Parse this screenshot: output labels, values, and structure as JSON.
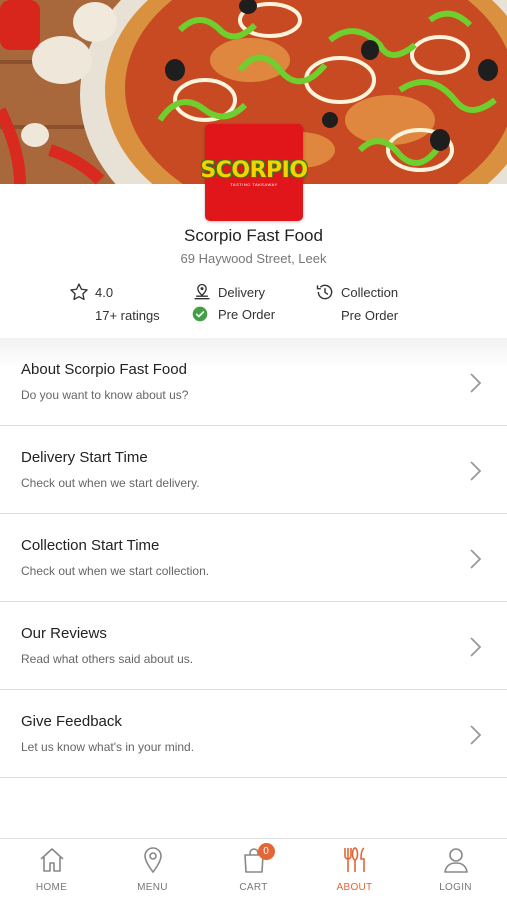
{
  "store": {
    "logo_text": "SCORPIO",
    "logo_subtext": "TASTING TAKEAWAY",
    "name": "Scorpio Fast Food",
    "address": "69 Haywood Street, Leek"
  },
  "stats": {
    "rating": "4.0",
    "ratings_count": "17+ ratings",
    "delivery_label": "Delivery",
    "delivery_mode": "Pre Order",
    "collection_label": "Collection",
    "collection_mode": "Pre Order"
  },
  "menu_items": [
    {
      "title": "About Scorpio Fast Food",
      "subtitle": "Do you want to know about us?"
    },
    {
      "title": "Delivery Start Time",
      "subtitle": "Check out when we start delivery."
    },
    {
      "title": "Collection Start Time",
      "subtitle": "Check out when we start collection."
    },
    {
      "title": "Our Reviews",
      "subtitle": "Read what others said about us."
    },
    {
      "title": "Give Feedback",
      "subtitle": "Let us know what's in your mind."
    }
  ],
  "nav": {
    "home": "HOME",
    "menu": "MENU",
    "cart": "CART",
    "cart_count": "0",
    "about": "ABOUT",
    "login": "LOGIN",
    "active": "about"
  },
  "colors": {
    "accent": "#e46535",
    "logo_bg": "#e0161b",
    "success": "#43a047"
  },
  "icons": [
    "star-icon",
    "delivery-pin-icon",
    "check-circle-icon",
    "history-clock-icon",
    "chevron-right-icon",
    "home-icon",
    "location-pin-icon",
    "cart-bag-icon",
    "fork-knife-icon",
    "user-icon"
  ]
}
